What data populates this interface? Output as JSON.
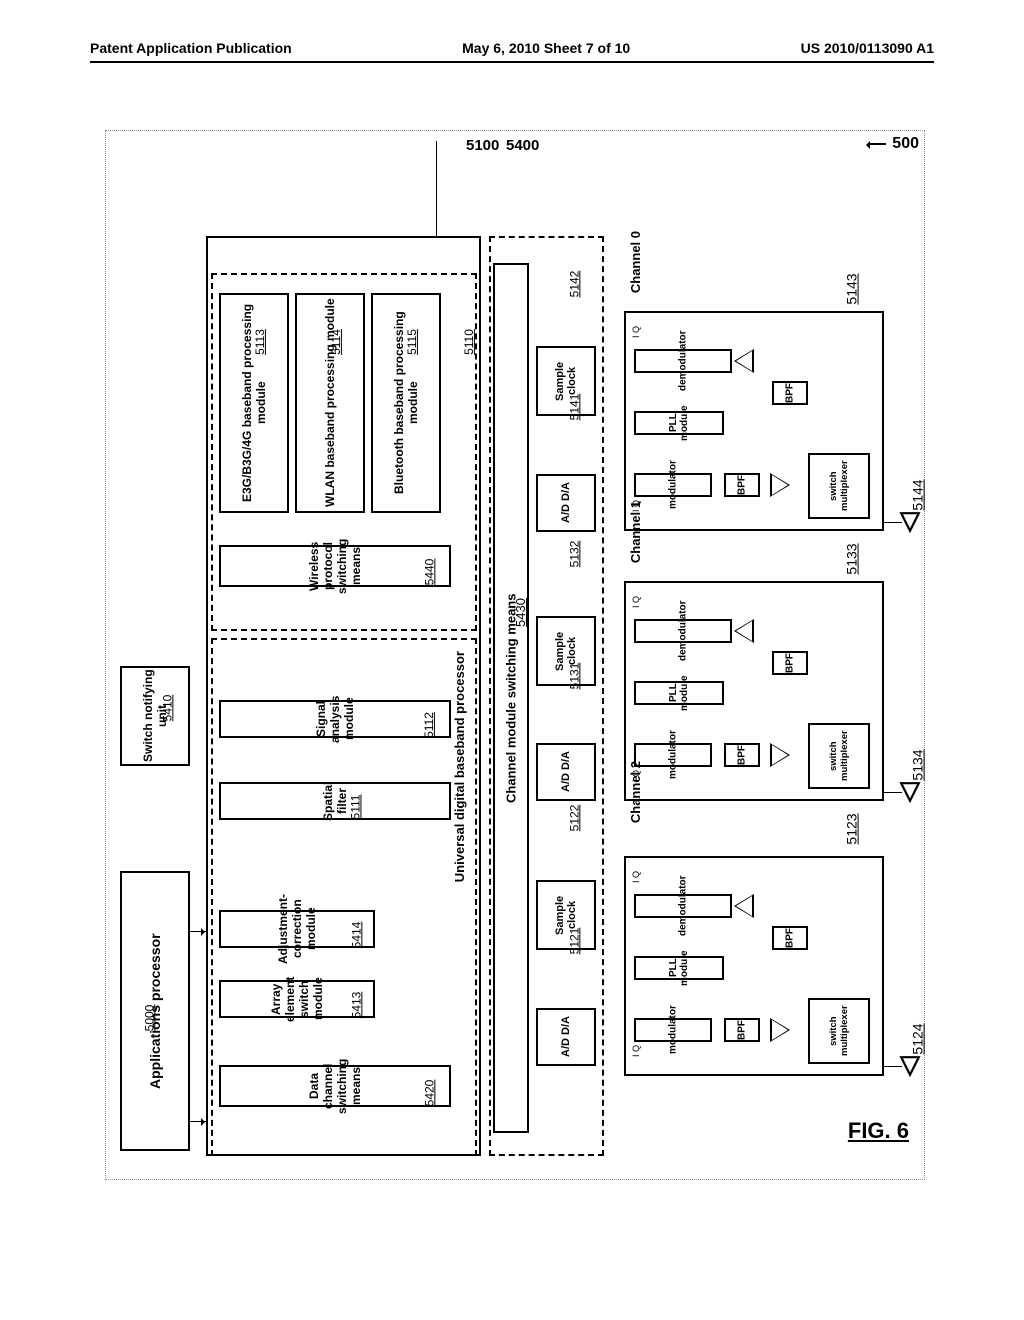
{
  "header": {
    "left": "Patent Application Publication",
    "center": "May 6, 2010  Sheet 7 of 10",
    "right": "US 2010/0113090 A1"
  },
  "figure_label": "FIG. 6",
  "refs": {
    "system": "500",
    "ubb_lead": "5100",
    "sw_lead": "5400",
    "app_proc": "5000",
    "switch_notify": "5410",
    "data_ch_sw": "5420",
    "array_elem": "5413",
    "adj_corr": "5414",
    "spatial_filter": "5111",
    "sig_analysis": "5112",
    "wproto_sw": "5440",
    "e3g": "5113",
    "wlan": "5114",
    "bt": "5115",
    "ubb_name": "5110",
    "ch_sw_means": "5430",
    "adc2": "5121",
    "sclk2": "5122",
    "rf2": "5123",
    "ant2": "5124",
    "adc1": "5131",
    "sclk1": "5132",
    "rf1": "5133",
    "ant1": "5134",
    "adc0": "5141",
    "sclk0": "5142",
    "rf0": "5143",
    "ant0": "5144"
  },
  "labels": {
    "app_proc": "Applications processor",
    "switch_notify": "Switch notifying unit",
    "ubb": "Universal digital baseband processor",
    "data_ch_sw": "Data channel switching means",
    "array_elem": "Array element switch module",
    "adj_corr": "Adjustment-correction module",
    "spatial_filter": "Spatial filter",
    "sig_analysis": "Signal analysis module",
    "wproto_sw": "Wireless protocol switching means",
    "e3g": "E3G/B3G/4G baseband processing module",
    "wlan": "WLAN baseband processing module",
    "bt": "Bluetooth baseband processing module",
    "ch_sw_means": "Channel module switching means",
    "adc": "A/D  D/A",
    "sclk": "Sample clock",
    "ch2": "Channel 2",
    "ch1": "Channel 1",
    "ch0": "Channel 0",
    "modulator": "modulator",
    "demodulator": "demodulator",
    "pll": "PLL module",
    "bpf": "BPF",
    "swmux": "switch multiplexer",
    "iq": "I  Q"
  }
}
